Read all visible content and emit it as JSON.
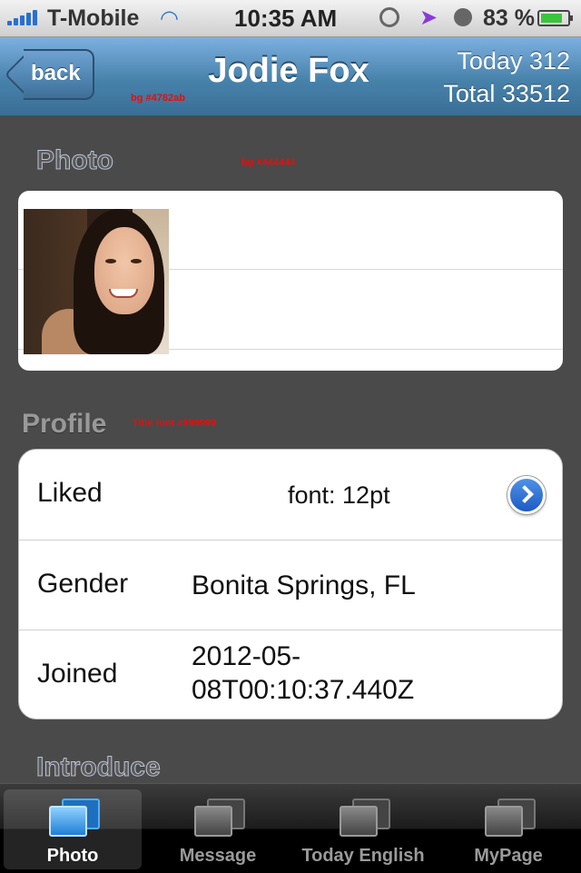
{
  "status_bar": {
    "carrier": "T-Mobile",
    "time": "10:35 AM",
    "battery_percent": "83 %",
    "battery_level": 0.83
  },
  "nav": {
    "back_label": "back",
    "title": "Jodie Fox",
    "today_label": "Today 312",
    "total_label": "Total 33512",
    "bg_annotation": "bg #4782ab",
    "bg_color": "#4782ab"
  },
  "photo_section": {
    "title": "Photo",
    "bg_annotation": "bg #444444"
  },
  "profile_section": {
    "title": "Profile",
    "title_annotation": "Title font #999999",
    "rows": [
      {
        "label": "Liked",
        "value": "font: 12pt",
        "has_disclosure": true
      },
      {
        "label": "Gender",
        "value": "Bonita Springs, FL"
      },
      {
        "label": "Joined",
        "value_line1": "2012-05-",
        "value_line2": "08T00:10:37.440Z"
      }
    ]
  },
  "introduce_section": {
    "title": "Introduce"
  },
  "tab_bar": {
    "tabs": [
      {
        "label": "Photo",
        "active": true
      },
      {
        "label": "Message",
        "active": false
      },
      {
        "label": "Today English",
        "active": false
      },
      {
        "label": "MyPage",
        "active": false
      }
    ]
  }
}
